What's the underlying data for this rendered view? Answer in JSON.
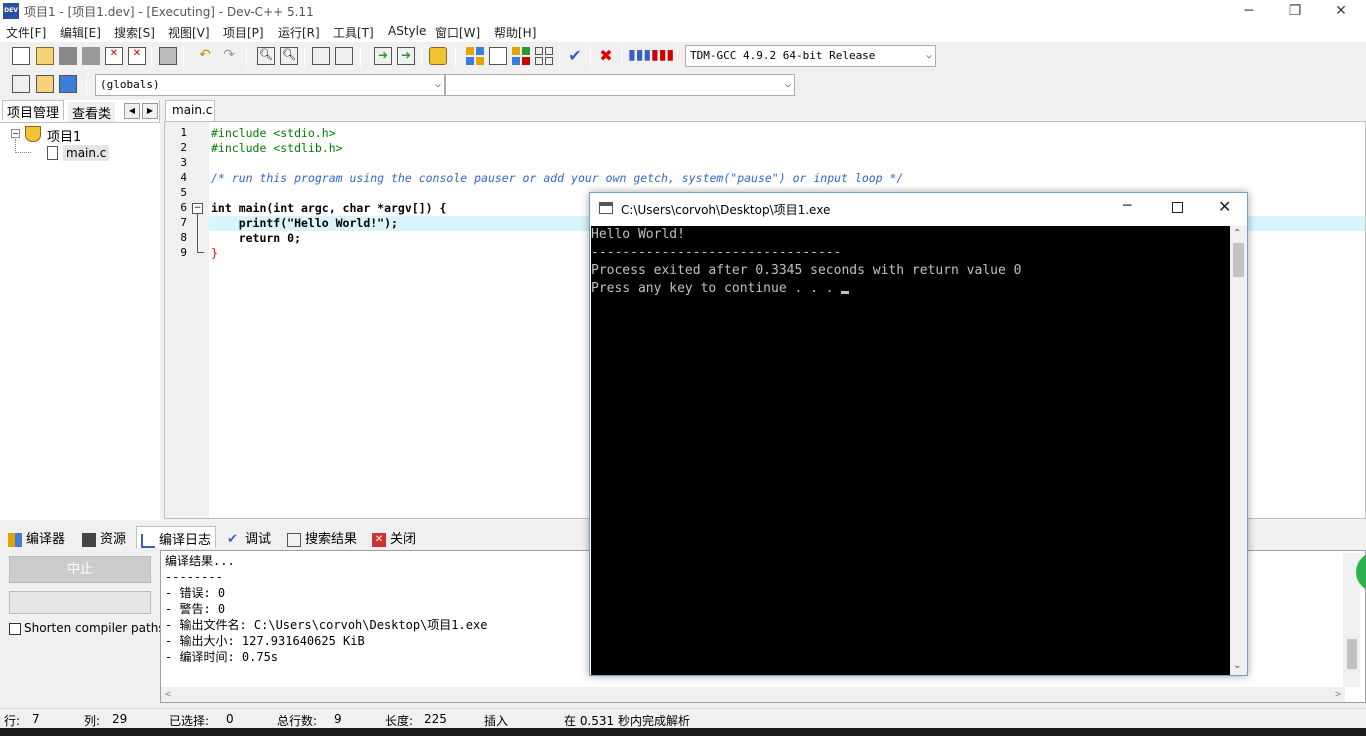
{
  "window": {
    "title": "项目1 - [项目1.dev] - [Executing] - Dev-C++ 5.11",
    "icon_text": "DEV",
    "min": "─",
    "restore": "❐",
    "close": "✕"
  },
  "menu": [
    "文件[F]",
    "编辑[E]",
    "搜索[S]",
    "视图[V]",
    "项目[P]",
    "运行[R]",
    "工具[T]",
    "AStyle",
    "窗口[W]",
    "帮助[H]"
  ],
  "toolbar": {
    "compiler": "TDM-GCC 4.9.2 64-bit Release",
    "scope": "(globals)",
    "member": ""
  },
  "left_panel": {
    "tabs": [
      "项目管理",
      "查看类"
    ],
    "project": "项目1",
    "file": "main.c"
  },
  "editor": {
    "tab": "main.c",
    "line_numbers": [
      "1",
      "2",
      "3",
      "4",
      "5",
      "6",
      "7",
      "8",
      "9"
    ],
    "lines": [
      "#include <stdio.h>",
      "#include <stdlib.h>",
      "",
      "/* run this program using the console pauser or add your own getch, system(\"pause\") or input loop */",
      "",
      "int main(int argc, char *argv[]) {",
      "    printf(\"Hello World!\");",
      "    return 0;",
      "}"
    ]
  },
  "bottom_tabs": [
    "编译器",
    "资源",
    "编译日志",
    "调试",
    "搜索结果",
    "关闭"
  ],
  "compile_panel": {
    "stop_button": "中止",
    "shorten_label": "Shorten compiler paths",
    "log": [
      "编译结果...",
      "--------",
      "- 错误: 0",
      "- 警告: 0",
      "- 输出文件名: C:\\Users\\corvoh\\Desktop\\项目1.exe",
      "- 输出大小: 127.931640625 KiB",
      "- 编译时间: 0.75s"
    ]
  },
  "status": {
    "row_label": "行:",
    "row": "7",
    "col_label": "列:",
    "col": "29",
    "sel_label": "已选择:",
    "sel": "0",
    "total_label": "总行数:",
    "total": "9",
    "len_label": "长度:",
    "len": "225",
    "mode": "插入",
    "parse": "在 0.531 秒内完成解析"
  },
  "console": {
    "title": "C:\\Users\\corvoh\\Desktop\\项目1.exe",
    "lines": [
      "Hello World!",
      "--------------------------------",
      "Process exited after 0.3345 seconds with return value 0",
      "Press any key to continue . . . "
    ]
  },
  "colors": {
    "accent": "#0078d7",
    "console_bg": "#000000",
    "highlight_line": "#d8f4fc"
  }
}
